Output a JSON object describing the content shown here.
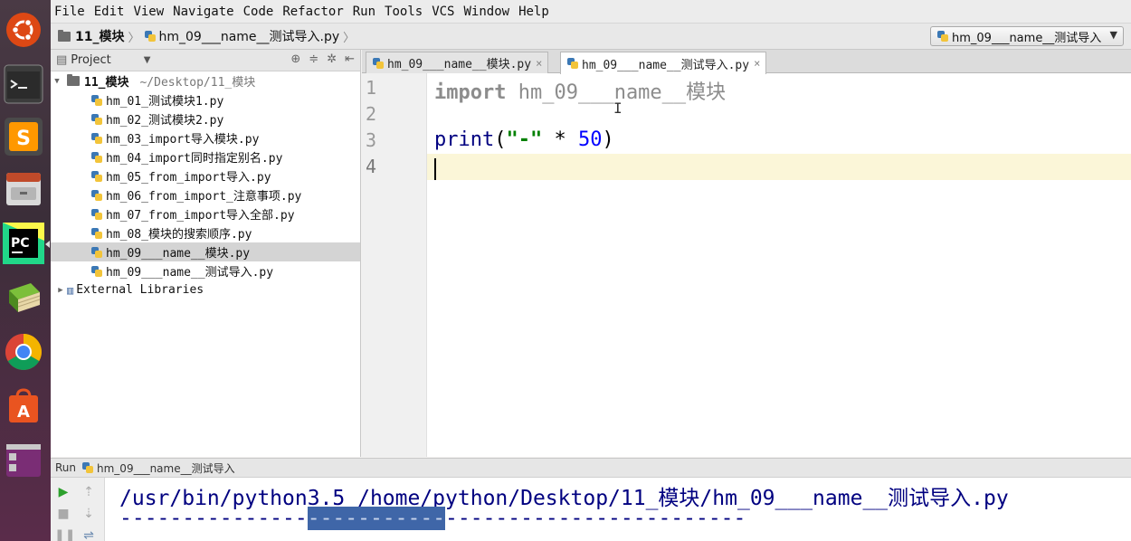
{
  "menubar": {
    "items": [
      "File",
      "Edit",
      "View",
      "Navigate",
      "Code",
      "Refactor",
      "Run",
      "Tools",
      "VCS",
      "Window",
      "Help"
    ]
  },
  "navbar": {
    "project_crumb": "11_模块",
    "file_crumb": "hm_09___name__测试导入.py",
    "run_config": "hm_09___name__测试导入"
  },
  "project": {
    "header_label": "Project",
    "root_name": "11_模块",
    "root_path": "~/Desktop/11_模块",
    "files": [
      "hm_01_测试模块1.py",
      "hm_02_测试模块2.py",
      "hm_03_import导入模块.py",
      "hm_04_import同时指定别名.py",
      "hm_05_from_import导入.py",
      "hm_06_from_import_注意事项.py",
      "hm_07_from_import导入全部.py",
      "hm_08_模块的搜索顺序.py",
      "hm_09___name__模块.py",
      "hm_09___name__测试导入.py"
    ],
    "selected_index": 8,
    "external_libraries": "External Libraries"
  },
  "editor": {
    "tabs": [
      {
        "label": "hm_09___name__模块.py",
        "active": false
      },
      {
        "label": "hm_09___name__测试导入.py",
        "active": true
      }
    ],
    "line_numbers": [
      "1",
      "2",
      "3",
      "4"
    ],
    "current_line": 4,
    "code": {
      "line1_keyword": "import",
      "line1_module": "hm_09___name__模块",
      "line3_fn": "print",
      "line3_open": "(",
      "line3_string": "\"-\"",
      "line3_op": " * ",
      "line3_number": "50",
      "line3_close": ")"
    }
  },
  "run": {
    "header_label": "Run",
    "header_config": "hm_09___name__测试导入",
    "command": "/usr/bin/python3.5 /home/python/Desktop/11_模块/hm_09___name__测试导入.py",
    "output_dashes_before": "---------------",
    "output_dashes_selected": "-----------",
    "output_dashes_after": "------------------------"
  },
  "launcher": {
    "icons": [
      "ubuntu-dash-icon",
      "terminal-icon",
      "sublime-text-icon",
      "file-manager-icon",
      "pycharm-icon",
      "library-books-icon",
      "chrome-icon",
      "software-center-icon",
      "workspace-switcher-icon"
    ]
  },
  "colors": {
    "keyword": "#000080",
    "string": "#008000",
    "number": "#0000ff",
    "current_line": "#fbf6d8",
    "selection": "#3f66a8"
  }
}
